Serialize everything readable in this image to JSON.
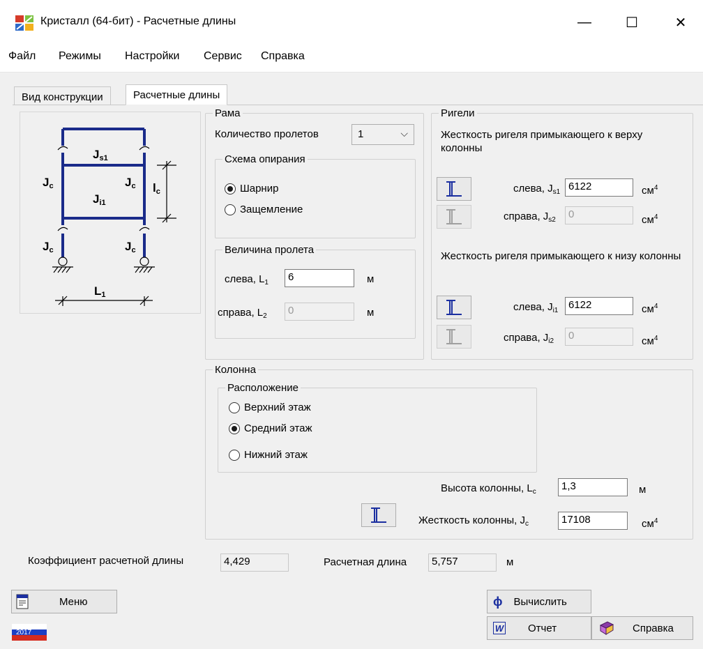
{
  "window": {
    "title": "Кристалл (64-бит) - Расчетные длины",
    "minimize": "—",
    "maximize": "☐",
    "close": "✕"
  },
  "menu": [
    "Файл",
    "Режимы",
    "Настройки",
    "Сервис",
    "Справка"
  ],
  "tabs": [
    "Вид конструкции",
    "Расчетные длины"
  ],
  "diagram": {
    "labels": {
      "js1": "J",
      "js1_sub": "s1",
      "ji1": "J",
      "ji1_sub": "i1",
      "jc": "J",
      "jc_sub": "c",
      "lc": "l",
      "lc_sub": "c",
      "l1": "L",
      "l1_sub": "1"
    }
  },
  "rama": {
    "title": "Рама",
    "spans_label": "Количество пролетов",
    "spans_value": "1",
    "support": {
      "title": "Схема опирания",
      "options": [
        "Шарнир",
        "Защемление"
      ],
      "selected": 0
    },
    "span": {
      "title": "Величина пролета",
      "left_label": "слева, L",
      "left_sub": "1",
      "left_value": "6",
      "right_label": "справа, L",
      "right_sub": "2",
      "right_value": "0",
      "unit": "м"
    }
  },
  "rigeli": {
    "title": "Ригели",
    "top_caption": "Жесткость ригеля примыкающего к верху колонны",
    "bottom_caption": "Жесткость ригеля примыкающего к низу колонны",
    "top_left_label": "слева, J",
    "top_left_sub": "s1",
    "top_left_value": "6122",
    "top_right_label": "справа, J",
    "top_right_sub": "s2",
    "top_right_value": "0",
    "bot_left_label": "слева, J",
    "bot_left_sub": "i1",
    "bot_left_value": "6122",
    "bot_right_label": "справа, J",
    "bot_right_sub": "i2",
    "bot_right_value": "0",
    "unit": "см",
    "unit_sup": "4"
  },
  "kolonna": {
    "title": "Колонна",
    "location": {
      "title": "Расположение",
      "options": [
        "Верхний этаж",
        "Средний этаж",
        "Нижний этаж"
      ],
      "selected": 1
    },
    "height_label": "Высота колонны, L",
    "height_sub": "c",
    "height_value": "1,3",
    "height_unit": "м",
    "stiff_label": "Жесткость колонны, J",
    "stiff_sub": "c",
    "stiff_value": "17108",
    "stiff_unit": "см",
    "stiff_unit_sup": "4"
  },
  "results": {
    "coef_label": "Коэффициент расчетной длины",
    "coef_value": "4,429",
    "len_label": "Расчетная длина",
    "len_value": "5,757",
    "len_unit": "м"
  },
  "buttons": {
    "menu": "Меню",
    "calculate": "Вычислить",
    "report": "Отчет",
    "help": "Справка"
  },
  "version_badge": "2017",
  "colors": {
    "frame": "#1a2b8a",
    "accent_blue": "#1b2fa0"
  }
}
